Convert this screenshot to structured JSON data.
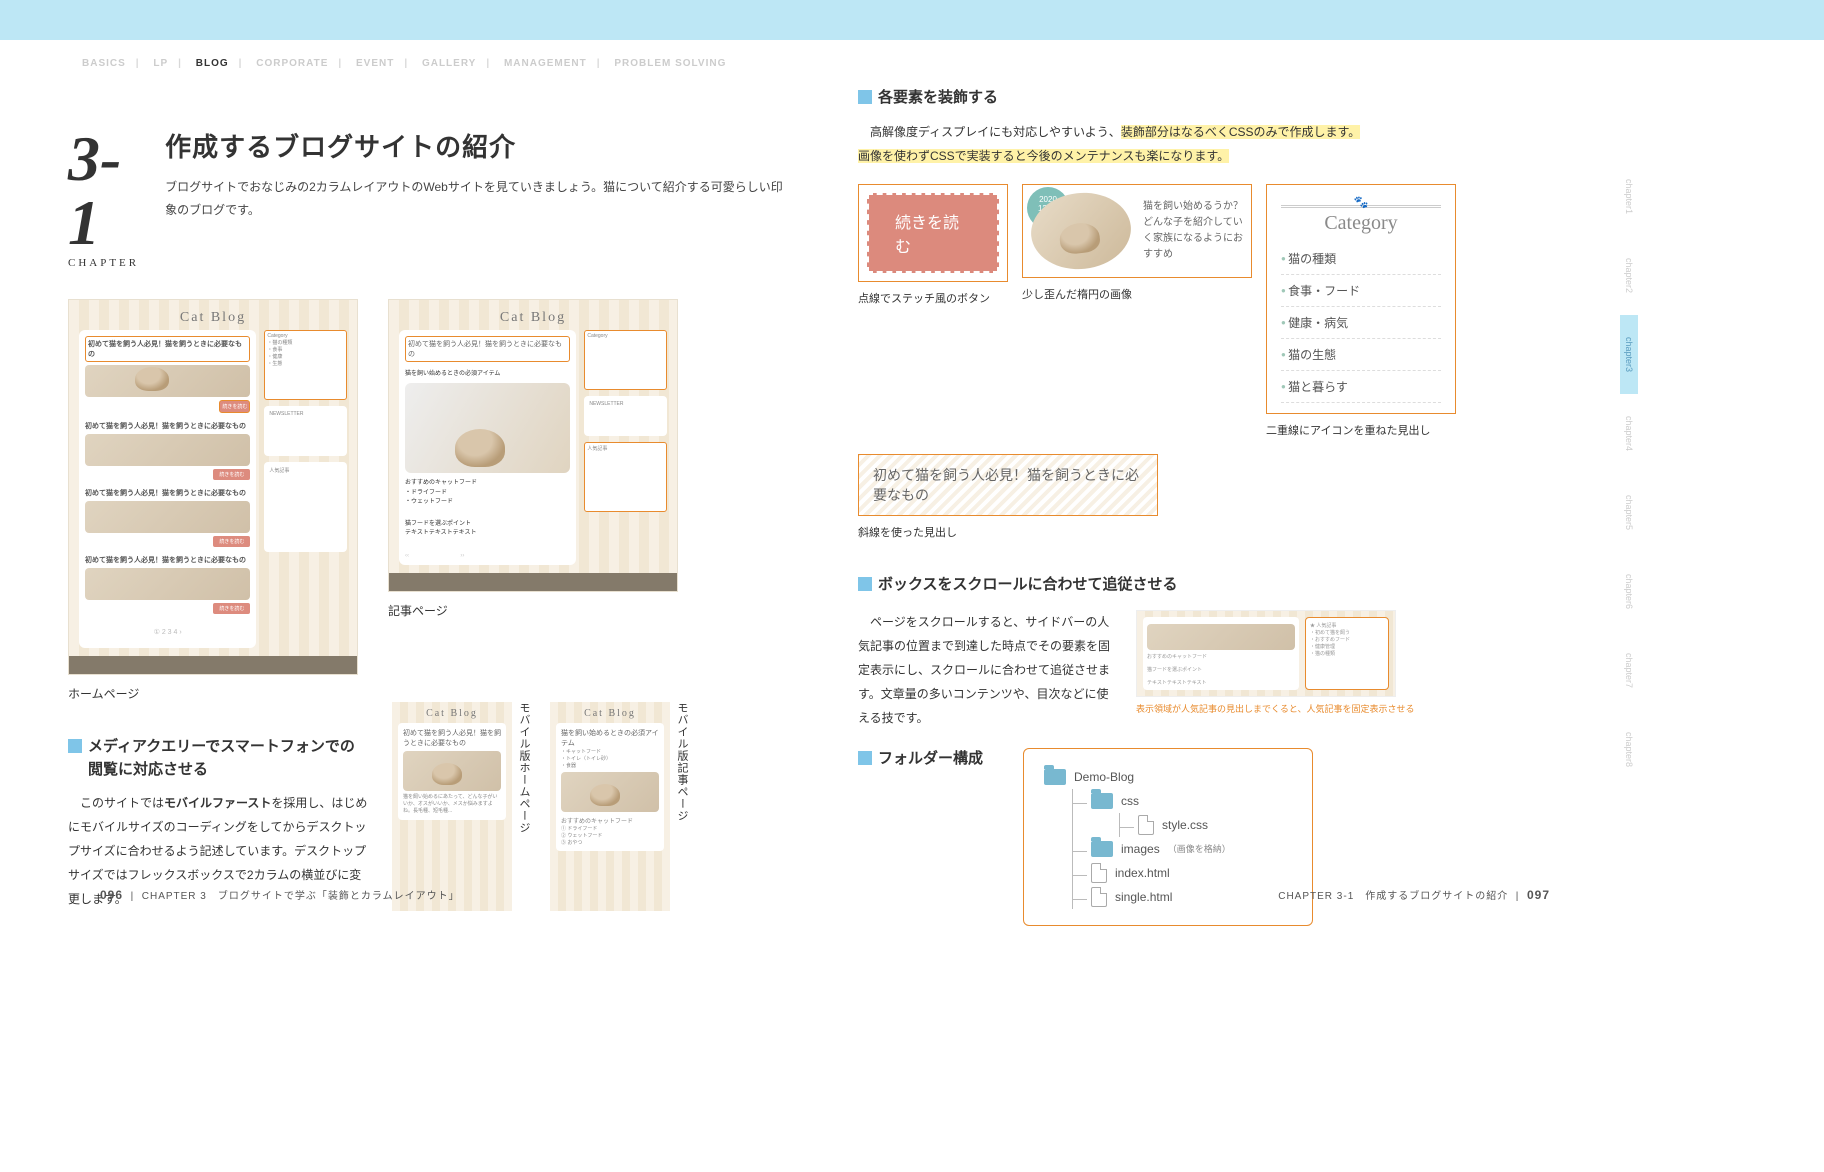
{
  "nav": {
    "items": [
      "BASICS",
      "LP",
      "BLOG",
      "CORPORATE",
      "EVENT",
      "GALLERY",
      "MANAGEMENT",
      "PROBLEM SOLVING"
    ],
    "active": "BLOG"
  },
  "left": {
    "chapter_num": "3-1",
    "chapter_label": "CHAPTER",
    "title": "作成するブログサイトの紹介",
    "intro": "ブログサイトでおなじみの2カラムレイアウトのWebサイトを見ていきましょう。猫について紹介する可愛らしい印象のブログです。",
    "mocks": {
      "logo": "Cat Blog",
      "post_title": "初めて猫を飼う人必見！猫を飼うときに必要なもの",
      "readmore": "続きを読む",
      "caption_home": "ホームページ",
      "caption_article": "記事ページ",
      "side_newsletter": "NEWSLETTER",
      "side_popular": "人気記事"
    },
    "section_media": {
      "heading": "メディアクエリーでスマートフォンでの閲覧に対応させる",
      "body_1": "このサイトでは",
      "body_bold": "モバイルファースト",
      "body_2": "を採用し、はじめにモバイルサイズのコーディングをしてからデスクトップサイズに合わせるよう記述しています。デスクトップサイズではフレックスボックスで2カラムの横並びに変更します。",
      "mobile_home_label": "モバイル版ホームページ",
      "mobile_article_label": "モバイル版記事ページ",
      "mobile_title1": "初めて猫を飼う人必見！猫を飼うときに必要なもの",
      "mobile_title2": "猫を飼い始めるときの必須アイテム",
      "mobile_popular": "おすすめのキャットフード"
    },
    "footer": {
      "page": "096",
      "text": "CHAPTER 3　ブログサイトで学ぶ「装飾とカラムレイアウト」"
    }
  },
  "right": {
    "section_decorate": {
      "heading": "各要素を装飾する",
      "body_plain": "高解像度ディスプレイにも対応しやすいよう、",
      "body_hl1": "装飾部分はなるべくCSSのみで作成します。",
      "body_hl2": "画像を使わずCSSで実装すると今後のメンテナンスも楽になります。"
    },
    "ex_button": {
      "label": "続きを読む",
      "caption": "点線でステッチ風のボタン"
    },
    "ex_ellipse": {
      "date_year": "2020",
      "date_day": "12/28",
      "text": "猫を飼い始めるうか？　どんな子を紹介していく家族になるようにおすすめ",
      "caption": "少し歪んだ楕円の画像"
    },
    "ex_category": {
      "title": "Category",
      "items": [
        "猫の種類",
        "食事・フード",
        "健康・病気",
        "猫の生態",
        "猫と暮らす"
      ],
      "caption": "二重線にアイコンを重ねた見出し"
    },
    "ex_stripe": {
      "text": "初めて猫を飼う人必見！猫を飼うときに必要なもの",
      "caption": "斜線を使った見出し"
    },
    "section_scroll": {
      "heading": "ボックスをスクロールに合わせて追従させる",
      "body": "ページをスクロールすると、サイドバーの人気記事の位置まで到達した時点でその要素を固定表示にし、スクロールに合わせて追従させます。文章量の多いコンテンツや、目次などに使える技です。",
      "mock_item1": "おすすめのキャットフード",
      "mock_item2": "猫フードを選ぶポイント",
      "caption": "表示領域が人気記事の見出しまでくると、人気記事を固定表示させる"
    },
    "section_folder": {
      "heading": "フォルダー構成",
      "root": "Demo-Blog",
      "css_dir": "css",
      "css_file": "style.css",
      "images_dir": "images",
      "images_note": "（画像を格納）",
      "index": "index.html",
      "single": "single.html"
    },
    "sidetabs": [
      "chapter1",
      "chapter2",
      "chapter3",
      "chapter4",
      "chapter5",
      "chapter6",
      "chapter7",
      "chapter8"
    ],
    "sidetab_active": "chapter3",
    "footer": {
      "text": "CHAPTER 3-1　作成するブログサイトの紹介",
      "page": "097"
    }
  }
}
